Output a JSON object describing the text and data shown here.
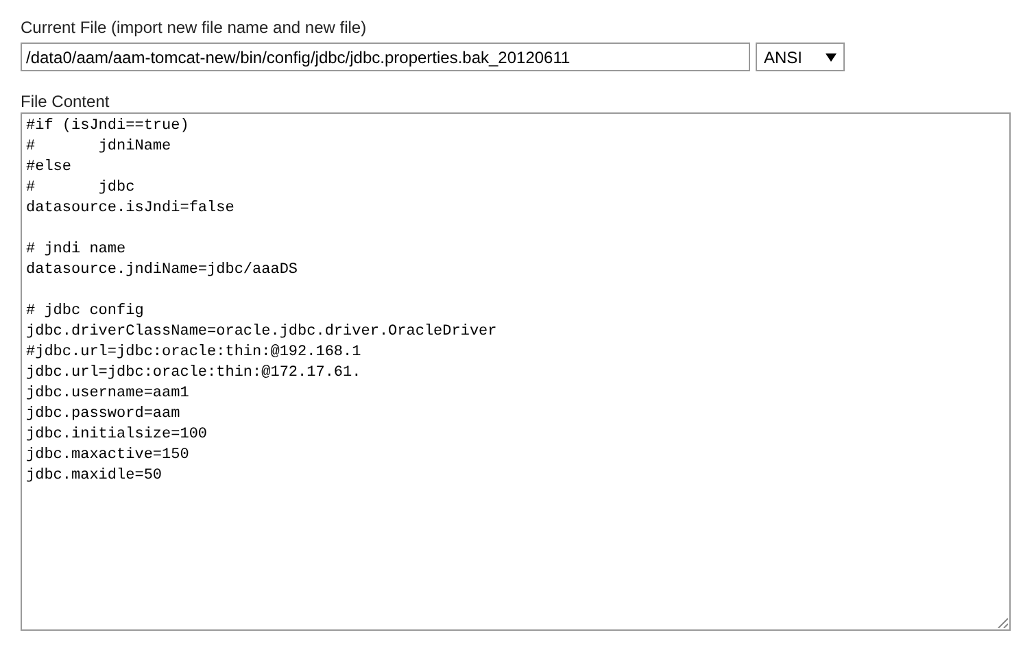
{
  "current_file": {
    "label": "Current File (import new file name and new file)",
    "value": "/data0/aam/aam-tomcat-new/bin/config/jdbc/jdbc.properties.bak_20120611",
    "encoding": "ANSI"
  },
  "file_content": {
    "label": "File Content",
    "blocks": [
      [
        "#if (isJndi==true)",
        "#\tjdniName",
        "#else",
        "#\tjdbc",
        "datasource.isJndi=false"
      ],
      [
        "# jndi name",
        "datasource.jndiName=jdbc/aaaDS"
      ],
      [
        "# jdbc config",
        "jdbc.driverClassName=oracle.jdbc.driver.OracleDriver",
        "#jdbc.url=jdbc:oracle:thin:@192.168.1",
        "jdbc.url=jdbc:oracle:thin:@172.17.61.",
        "jdbc.username=aam1",
        "jdbc.password=aam",
        "jdbc.initialsize=100",
        "jdbc.maxactive=150",
        "jdbc.maxidle=50"
      ]
    ]
  }
}
